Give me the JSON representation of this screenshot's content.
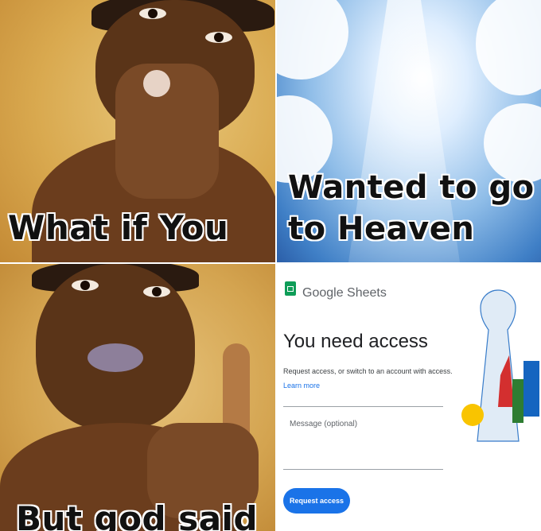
{
  "panels": {
    "top_left": {
      "caption": "What if You"
    },
    "top_right": {
      "caption_line1": "Wanted to go",
      "caption_line2": "to Heaven"
    },
    "bottom_left": {
      "caption": "But god said"
    },
    "bottom_right": {
      "brand": "Google Sheets",
      "title": "You need access",
      "description": "Request access, or switch to an account with access.",
      "learn_more": "Learn more",
      "message_placeholder": "Message (optional)",
      "button_label": "Request access"
    }
  },
  "colors": {
    "sheets_green": "#0f9d58",
    "button_blue": "#1a73e8"
  }
}
